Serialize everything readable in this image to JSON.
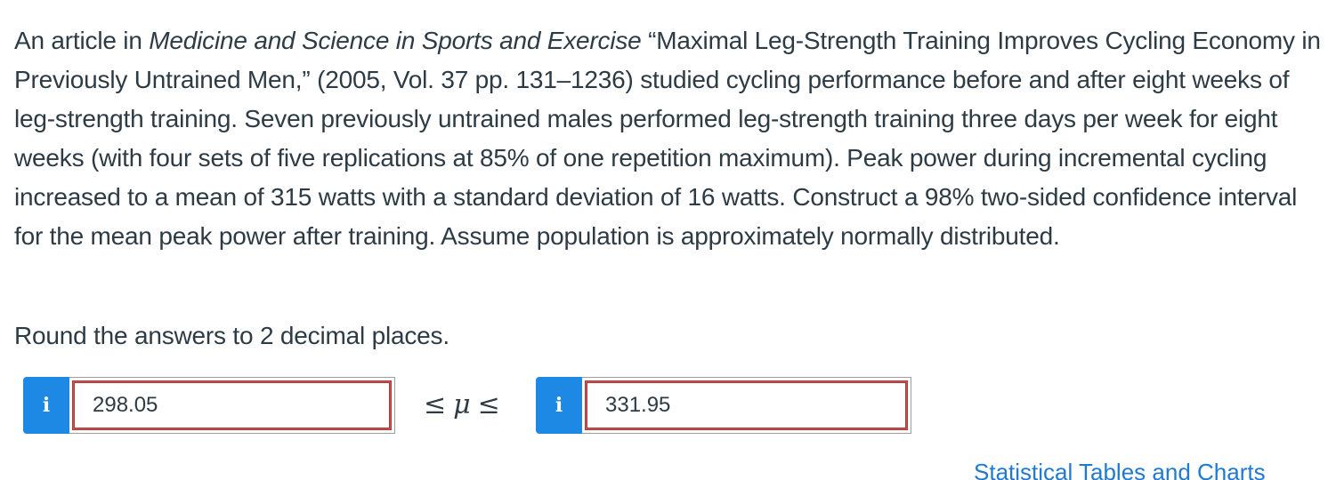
{
  "question": {
    "intro": "An article in ",
    "journal": "Medicine and Science in Sports and Exercise",
    "body": " “Maximal Leg-Strength Training Improves Cycling Economy in Previously Untrained Men,” (2005, Vol. 37 pp. 131–1236) studied cycling performance before and after eight weeks of leg-strength training. Seven previously untrained males performed leg-strength training three days per week for eight weeks (with four sets of five replications at 85% of one repetition maximum). Peak power during incremental cycling increased to a mean of 315 watts with a standard deviation of 16 watts. Construct a 98% two-sided confidence interval for the mean peak power after training. Assume population is approximately normally distributed."
  },
  "instruction": "Round the answers to 2 decimal places.",
  "answers": {
    "lower": {
      "info_label": "i",
      "value": "298.05"
    },
    "upper": {
      "info_label": "i",
      "value": "331.95"
    }
  },
  "inequality": {
    "left_symbol": "≤",
    "variable": "μ",
    "right_symbol": "≤"
  },
  "links": {
    "statistical_tables": "Statistical Tables and Charts"
  },
  "colors": {
    "info_button": "#1e88e5",
    "answer_border": "#b03a3a",
    "link": "#1f7ad0"
  }
}
